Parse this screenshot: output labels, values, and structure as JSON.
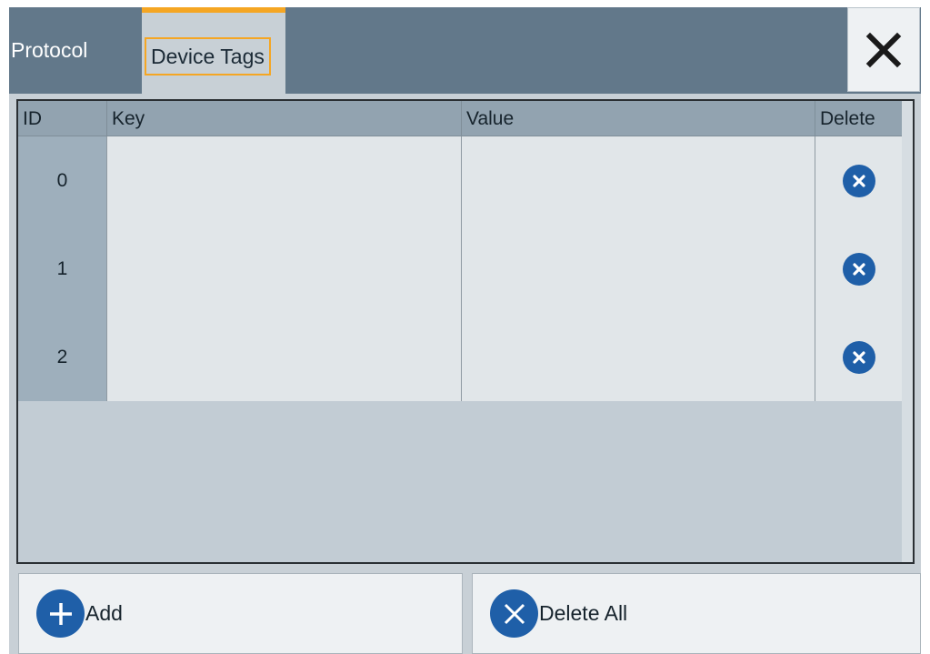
{
  "tabs": [
    {
      "label": "Protocol",
      "selected": false
    },
    {
      "label": "Device Tags",
      "selected": true
    }
  ],
  "close_icon": "close-icon",
  "table": {
    "headers": {
      "id": "ID",
      "key": "Key",
      "value": "Value",
      "delete": "Delete"
    },
    "rows": [
      {
        "id": "0",
        "key": "",
        "value": ""
      },
      {
        "id": "1",
        "key": "",
        "value": ""
      },
      {
        "id": "2",
        "key": "",
        "value": ""
      }
    ],
    "delete_icon": "delete-circle-x-icon"
  },
  "footer": {
    "add_label": "Add",
    "add_icon": "plus-circle-icon",
    "delete_all_label": "Delete All",
    "delete_all_icon": "x-circle-icon"
  },
  "colors": {
    "header_bg": "#62788a",
    "accent": "#f5a623",
    "icon_blue": "#1f5fa8"
  }
}
